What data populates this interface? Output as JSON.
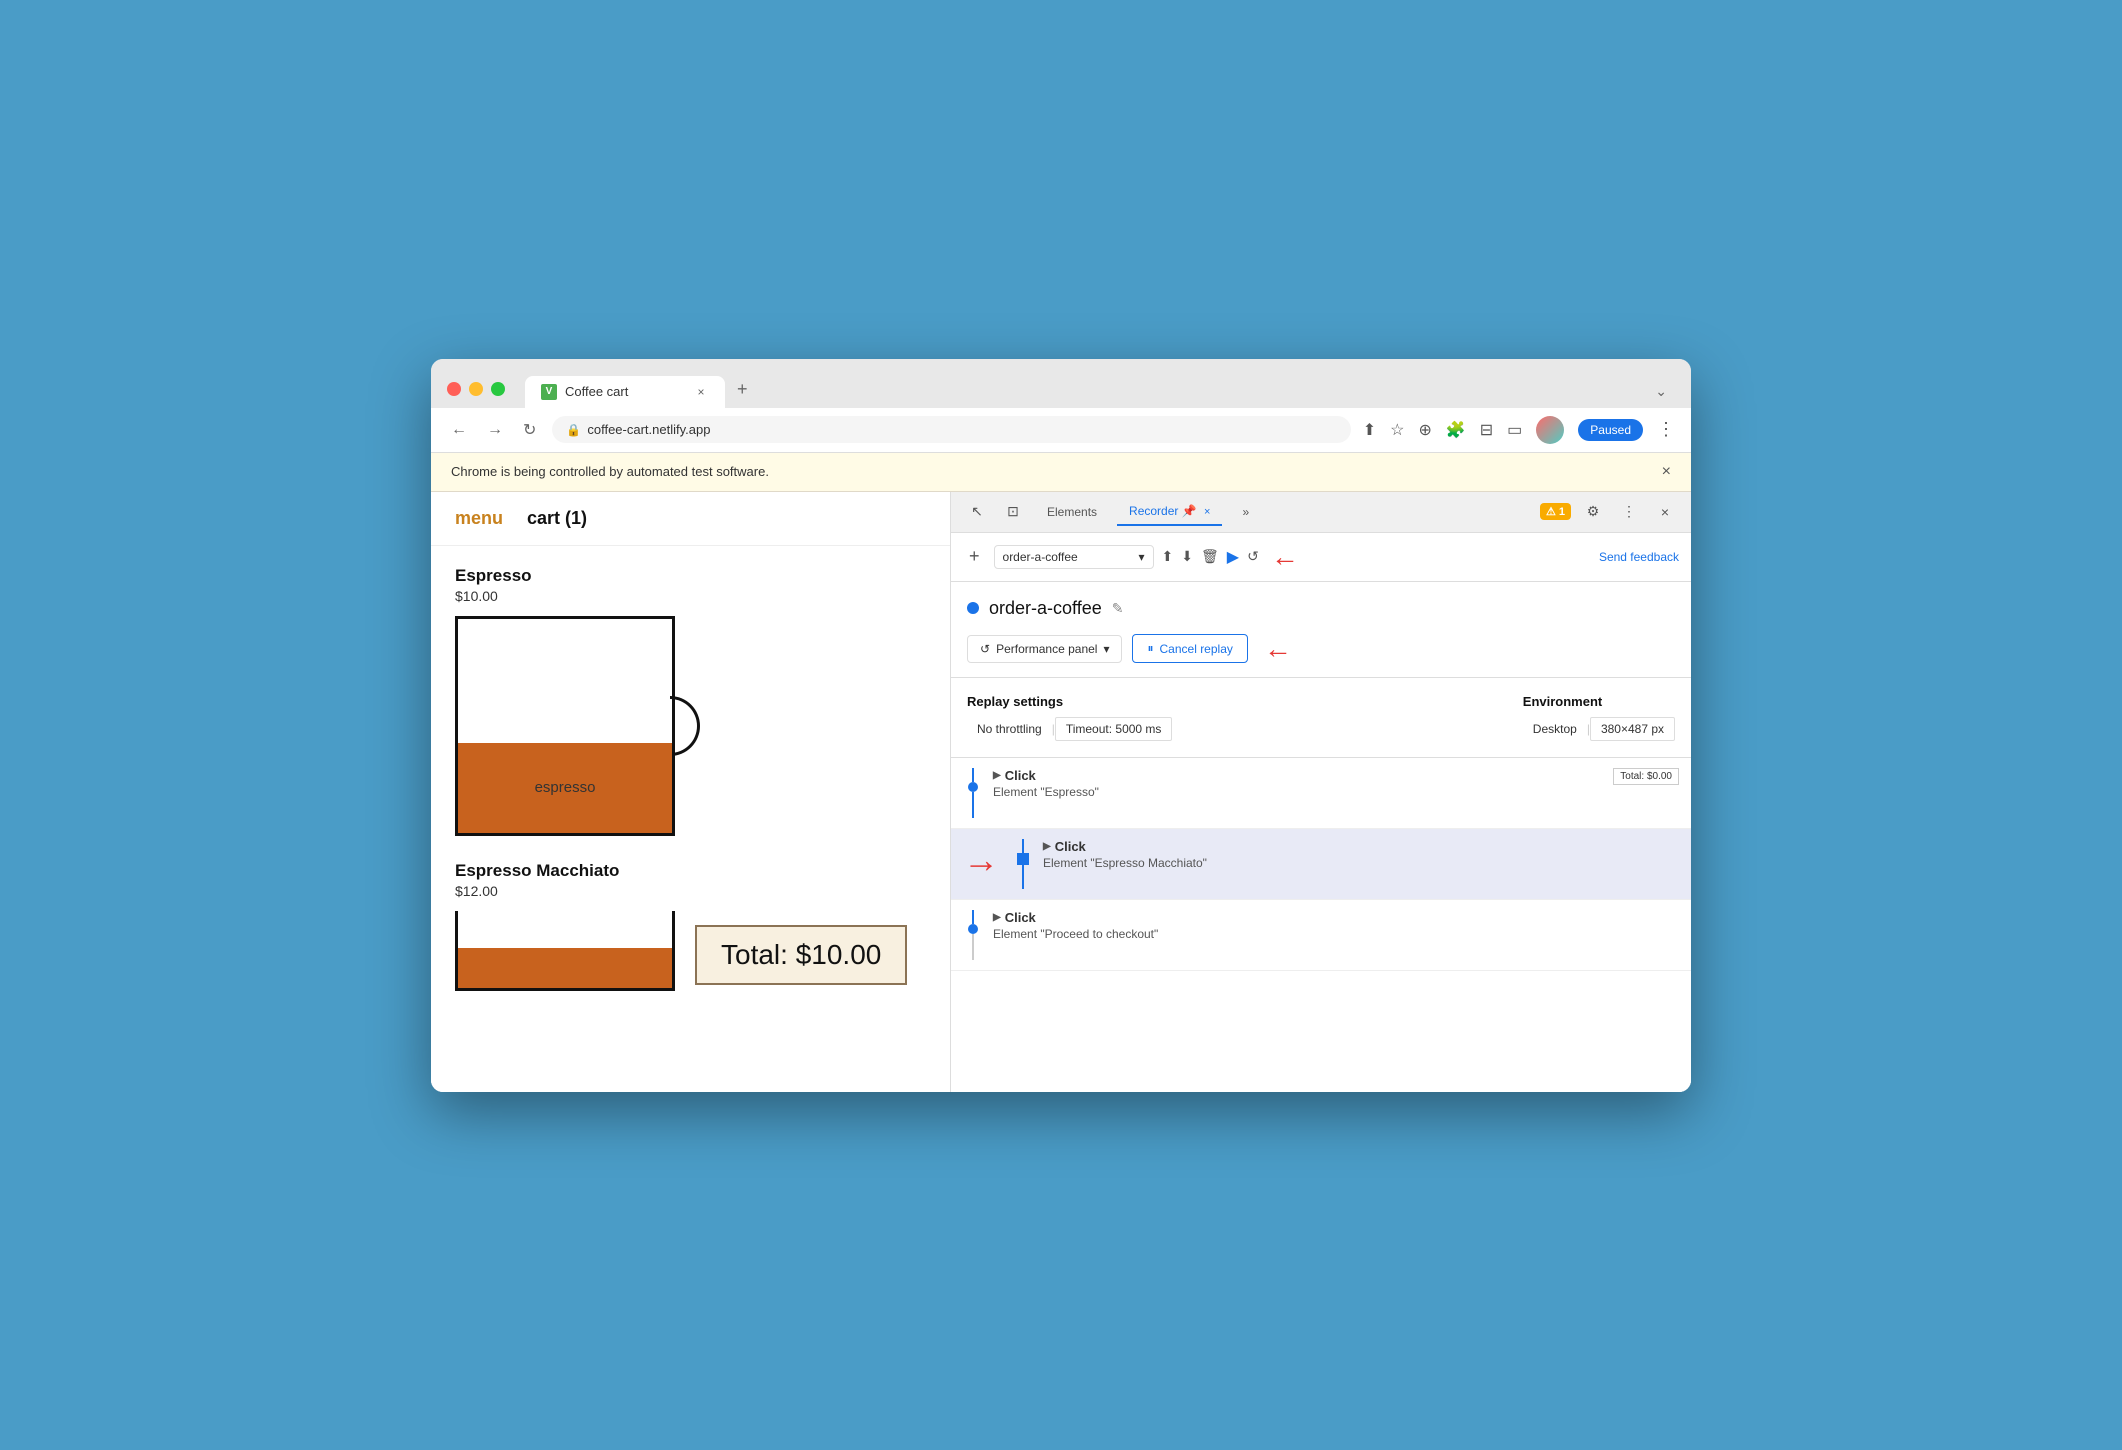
{
  "browser": {
    "traffic_lights": [
      "red",
      "yellow",
      "green"
    ],
    "tab": {
      "favicon_letter": "V",
      "title": "Coffee cart",
      "close_label": "×",
      "new_tab_label": "+",
      "menu_label": "⌄"
    },
    "address_bar": {
      "lock_icon": "🔒",
      "url": "coffee-cart.netlify.app",
      "share_icon": "⬆",
      "bookmark_icon": "☆",
      "extension_icon": "⊕",
      "devtools_icon": "🔧",
      "sidebar_icon": "⊟",
      "window_icon": "▭",
      "paused_label": "Paused",
      "more_icon": "⋮"
    },
    "automated_notice": {
      "text": "Chrome is being controlled by automated test software.",
      "close_label": "×"
    }
  },
  "webapp": {
    "nav": {
      "menu_label": "menu",
      "cart_label": "cart (1)"
    },
    "products": [
      {
        "name": "Espresso",
        "price": "$10.00",
        "cup_label": "espresso"
      },
      {
        "name": "Espresso Macchiato",
        "price": "$12.00"
      }
    ],
    "total": {
      "label": "Total: $10.00"
    }
  },
  "devtools": {
    "tabs": [
      {
        "label": "Elements",
        "active": false
      },
      {
        "label": "Recorder",
        "active": true
      },
      {
        "label": "📌",
        "active": false
      },
      {
        "label": "×",
        "active": false
      },
      {
        "label": "»",
        "active": false
      }
    ],
    "badge": "1",
    "icons": {
      "gear": "⚙",
      "more": "⋮",
      "close": "×",
      "cursor": "↖",
      "responsive": "⊡"
    },
    "toolbar": {
      "add_label": "+",
      "recording_name": "order-a-coffee",
      "dropdown_arrow": "▾",
      "upload_icon": "⬆",
      "download_icon": "⬇",
      "delete_icon": "🗑",
      "replay_icon": "▶",
      "replay_slow_icon": "↺",
      "send_feedback": "Send feedback"
    },
    "recording": {
      "title": "order-a-coffee",
      "blue_dot": true,
      "edit_icon": "✎"
    },
    "replay_controls": {
      "performance_icon": "↺",
      "performance_label": "Performance panel",
      "dropdown_arrow": "▾",
      "pause_icon": "⏸",
      "cancel_label": "Cancel replay"
    },
    "replay_settings": {
      "title": "Replay settings",
      "no_throttling": "No throttling",
      "timeout": "Timeout: 5000 ms",
      "environment_title": "Environment",
      "desktop": "Desktop",
      "dimensions": "380×487 px"
    },
    "steps": [
      {
        "id": 1,
        "type": "click",
        "action": "Click",
        "element": "Element \"Espresso\"",
        "has_preview": true,
        "preview_text": "Total: $0.00",
        "highlighted": false,
        "dot_type": "circle"
      },
      {
        "id": 2,
        "type": "click",
        "action": "Click",
        "element": "Element \"Espresso Macchiato\"",
        "has_preview": false,
        "highlighted": true,
        "dot_type": "square",
        "has_red_arrow": true
      },
      {
        "id": 3,
        "type": "click",
        "action": "Click",
        "element": "Element \"Proceed to checkout\"",
        "has_preview": false,
        "highlighted": false,
        "dot_type": "circle"
      }
    ]
  }
}
